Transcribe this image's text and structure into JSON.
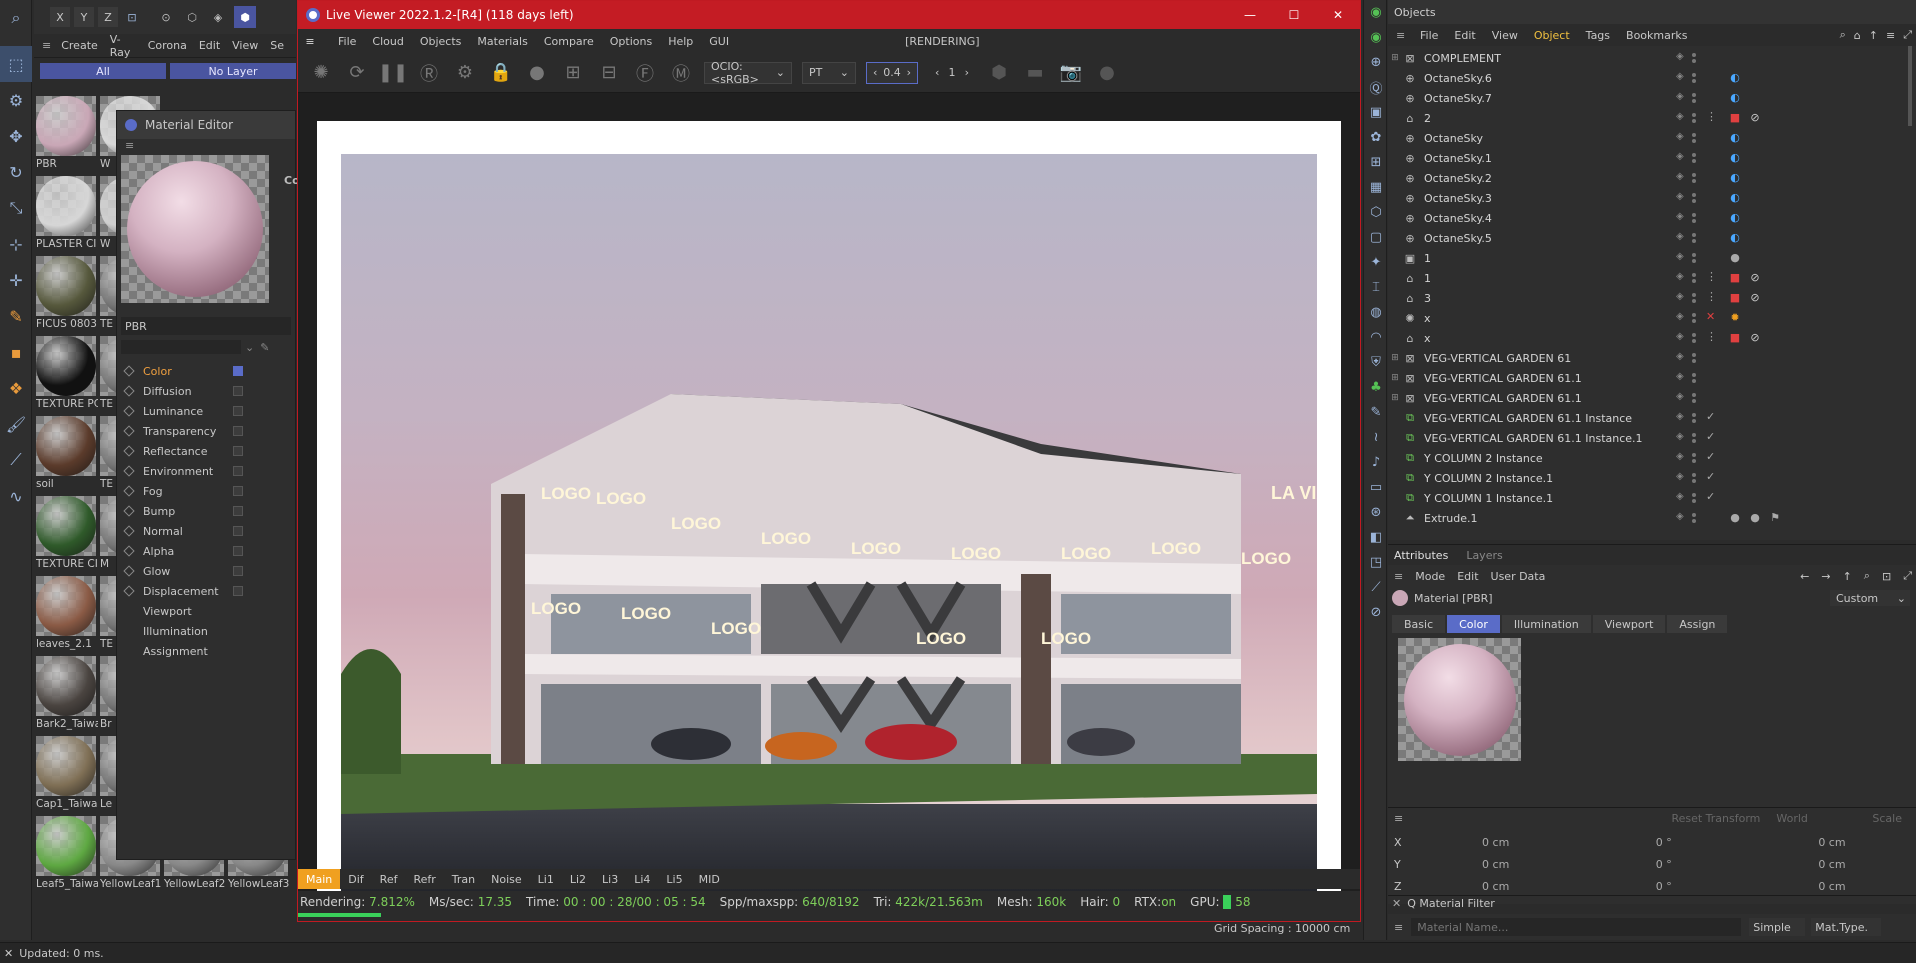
{
  "left_toolbar": {
    "axis_buttons": [
      "X",
      "Y",
      "Z"
    ],
    "menu": [
      "Create",
      "V-Ray",
      "Corona",
      "Edit",
      "View",
      "Se"
    ],
    "filter_all": "All",
    "filter_layer": "No Layer"
  },
  "material_browser": {
    "materials": [
      {
        "label": "PBR",
        "color": "#c9a7b6"
      },
      {
        "label": "W",
        "color": "#d8d8d8"
      },
      {
        "label": "PLASTER CI",
        "color": "#d6d6d6"
      },
      {
        "label": "W",
        "color": "#cfcfcf"
      },
      {
        "label": "FICUS 0803",
        "color": "#56583c"
      },
      {
        "label": "TE",
        "color": "#777"
      },
      {
        "label": "TEXTURE PC",
        "color": "#111111"
      },
      {
        "label": "TE",
        "color": "#777"
      },
      {
        "label": "soil",
        "color": "#5b3b2b"
      },
      {
        "label": "TE",
        "color": "#777"
      },
      {
        "label": "TEXTURE CI",
        "color": "#2f5a2a"
      },
      {
        "label": "M",
        "color": "#777"
      },
      {
        "label": "leaves_2.1",
        "color": "#8a5a45"
      },
      {
        "label": "TE",
        "color": "#777"
      },
      {
        "label": "Bark2_Taiwa",
        "color": "#4a4440"
      },
      {
        "label": "Br",
        "color": "#777"
      },
      {
        "label": "Cap1_Taiwa",
        "color": "#7f6f55"
      },
      {
        "label": "Le",
        "color": "#777"
      },
      {
        "label": "Leaf5_Taiwa",
        "color": "#5ea842"
      },
      {
        "label": "YellowLeaf1",
        "color": "#888"
      },
      {
        "label": "YellowLeaf2",
        "color": "#888"
      },
      {
        "label": "YellowLeaf3",
        "color": "#888"
      }
    ]
  },
  "material_editor": {
    "title": "Material Editor",
    "name": "PBR",
    "right_label": "Co",
    "channels": [
      {
        "label": "Color",
        "checked": true,
        "active": true
      },
      {
        "label": "Diffusion",
        "checked": false
      },
      {
        "label": "Luminance",
        "checked": false
      },
      {
        "label": "Transparency",
        "checked": false
      },
      {
        "label": "Reflectance",
        "checked": false
      },
      {
        "label": "Environment",
        "checked": false
      },
      {
        "label": "Fog",
        "checked": false
      },
      {
        "label": "Bump",
        "checked": false
      },
      {
        "label": "Normal",
        "checked": false
      },
      {
        "label": "Alpha",
        "checked": false
      },
      {
        "label": "Glow",
        "checked": false
      },
      {
        "label": "Displacement",
        "checked": false
      }
    ],
    "extra": [
      "Viewport",
      "Illumination",
      "Assignment"
    ]
  },
  "live_viewer": {
    "title": "Live Viewer 2022.1.2-[R4] (118 days left)",
    "menu": [
      "File",
      "Cloud",
      "Objects",
      "Materials",
      "Compare",
      "Options",
      "Help",
      "GUI"
    ],
    "state": "[RENDERING]",
    "ocio": "OCIO:<sRGB>",
    "kernel": "PT",
    "zoom": "0.4",
    "step": "1",
    "passes": [
      "Main",
      "Dif",
      "Ref",
      "Refr",
      "Tran",
      "Noise",
      "Li1",
      "Li2",
      "Li3",
      "Li4",
      "Li5",
      "MID"
    ],
    "status": {
      "rendering_label": "Rendering:",
      "rendering_value": "7.812%",
      "mssec_label": "Ms/sec:",
      "mssec_value": "17.35",
      "time_label": "Time:",
      "time_value": "00 : 00 : 28/00 : 05 : 54",
      "spp_label": "Spp/maxspp:",
      "spp_value": "640/8192",
      "tri_label": "Tri:",
      "tri_value": "422k/21.563m",
      "mesh_label": "Mesh:",
      "mesh_value": "160k",
      "hair_label": "Hair:",
      "hair_value": "0",
      "rtx_label": "RTX:",
      "rtx_value": "on",
      "gpu_label": "GPU:",
      "gpu_value": "58"
    },
    "progress": 0.07812,
    "signs": [
      "LOGO",
      "LOGO",
      "LOGO",
      "LOGO",
      "LOGO",
      "LOGO",
      "LOGO",
      "LOGO",
      "LOGO",
      "LOGO",
      "LOGO",
      "LOGO",
      "LOGO",
      "LOGO",
      "LA VIA"
    ]
  },
  "objects_panel": {
    "tab": "Objects",
    "menu": [
      "File",
      "Edit",
      "View",
      "Object",
      "Tags",
      "Bookmarks"
    ],
    "rows": [
      {
        "name": "COMPLEMENT",
        "icon": "layer",
        "expand": true,
        "tags": []
      },
      {
        "name": "OctaneSky.6",
        "icon": "sky",
        "tags": [
          "half"
        ]
      },
      {
        "name": "OctaneSky.7",
        "icon": "sky",
        "tags": [
          "half"
        ]
      },
      {
        "name": "2",
        "icon": "cam",
        "tags": [
          "cam",
          "no"
        ]
      },
      {
        "name": "OctaneSky",
        "icon": "sky",
        "tags": [
          "half"
        ]
      },
      {
        "name": "OctaneSky.1",
        "icon": "sky",
        "tags": [
          "half"
        ]
      },
      {
        "name": "OctaneSky.2",
        "icon": "sky",
        "tags": [
          "half"
        ]
      },
      {
        "name": "OctaneSky.3",
        "icon": "sky",
        "tags": [
          "half"
        ]
      },
      {
        "name": "OctaneSky.4",
        "icon": "sky",
        "tags": [
          "half"
        ]
      },
      {
        "name": "OctaneSky.5",
        "icon": "sky",
        "tags": [
          "half"
        ]
      },
      {
        "name": "1",
        "icon": "img",
        "tags": [
          "mat"
        ]
      },
      {
        "name": "1",
        "icon": "cam",
        "tags": [
          "cam",
          "no"
        ]
      },
      {
        "name": "3",
        "icon": "cam",
        "tags": [
          "cam",
          "no"
        ]
      },
      {
        "name": "x",
        "icon": "light",
        "tags": [
          "sun"
        ]
      },
      {
        "name": "x",
        "icon": "cam",
        "tags": [
          "cam",
          "no"
        ]
      },
      {
        "name": "VEG-VERTICAL GARDEN 61",
        "icon": "layer",
        "expand": true,
        "tags": []
      },
      {
        "name": "VEG-VERTICAL GARDEN 61.1",
        "icon": "layer",
        "expand": true,
        "tags": []
      },
      {
        "name": "VEG-VERTICAL GARDEN 61.1",
        "icon": "layer",
        "expand": true,
        "tags": []
      },
      {
        "name": "VEG-VERTICAL GARDEN 61.1 Instance",
        "icon": "inst",
        "tags": []
      },
      {
        "name": "VEG-VERTICAL GARDEN 61.1 Instance.1",
        "icon": "inst",
        "tags": []
      },
      {
        "name": "Y COLUMN 2 Instance",
        "icon": "inst",
        "tags": []
      },
      {
        "name": "Y COLUMN 2 Instance.1",
        "icon": "inst",
        "tags": []
      },
      {
        "name": "Y COLUMN 1 Instance.1",
        "icon": "inst",
        "tags": []
      },
      {
        "name": "Extrude.1",
        "icon": "extrude",
        "tags": [
          "mat",
          "mat",
          "flag"
        ]
      }
    ]
  },
  "attributes_panel": {
    "tabs": [
      "Attributes",
      "Layers"
    ],
    "menu": [
      "Mode",
      "Edit",
      "User Data"
    ],
    "object_label": "Material [PBR]",
    "preset": "Custom",
    "mat_tabs": [
      "Basic",
      "Color",
      "Illumination",
      "Viewport",
      "Assign"
    ],
    "reset_transform": "Reset Transform",
    "space": "World",
    "scale": "Scale",
    "coords": [
      {
        "axis": "X",
        "pos": "0 cm",
        "rot": "0 °",
        "size": "0 cm"
      },
      {
        "axis": "Y",
        "pos": "0 cm",
        "rot": "0 °",
        "size": "0 cm"
      },
      {
        "axis": "Z",
        "pos": "0 cm",
        "rot": "0 °",
        "size": "0 cm"
      }
    ],
    "filter_title": "Q Material Filter",
    "filter_placeholder": "Material Name...",
    "filter_mode": "Simple",
    "filter_type": "Mat.Type."
  },
  "viewport_hud": {
    "grid_spacing": "Grid Spacing : 10000 cm"
  },
  "status_bar": {
    "text": "Updated: 0 ms."
  },
  "colors": {
    "accent": "#5a6cc8",
    "viewer_frame": "#c41c24",
    "active_pass": "#f0a020"
  }
}
